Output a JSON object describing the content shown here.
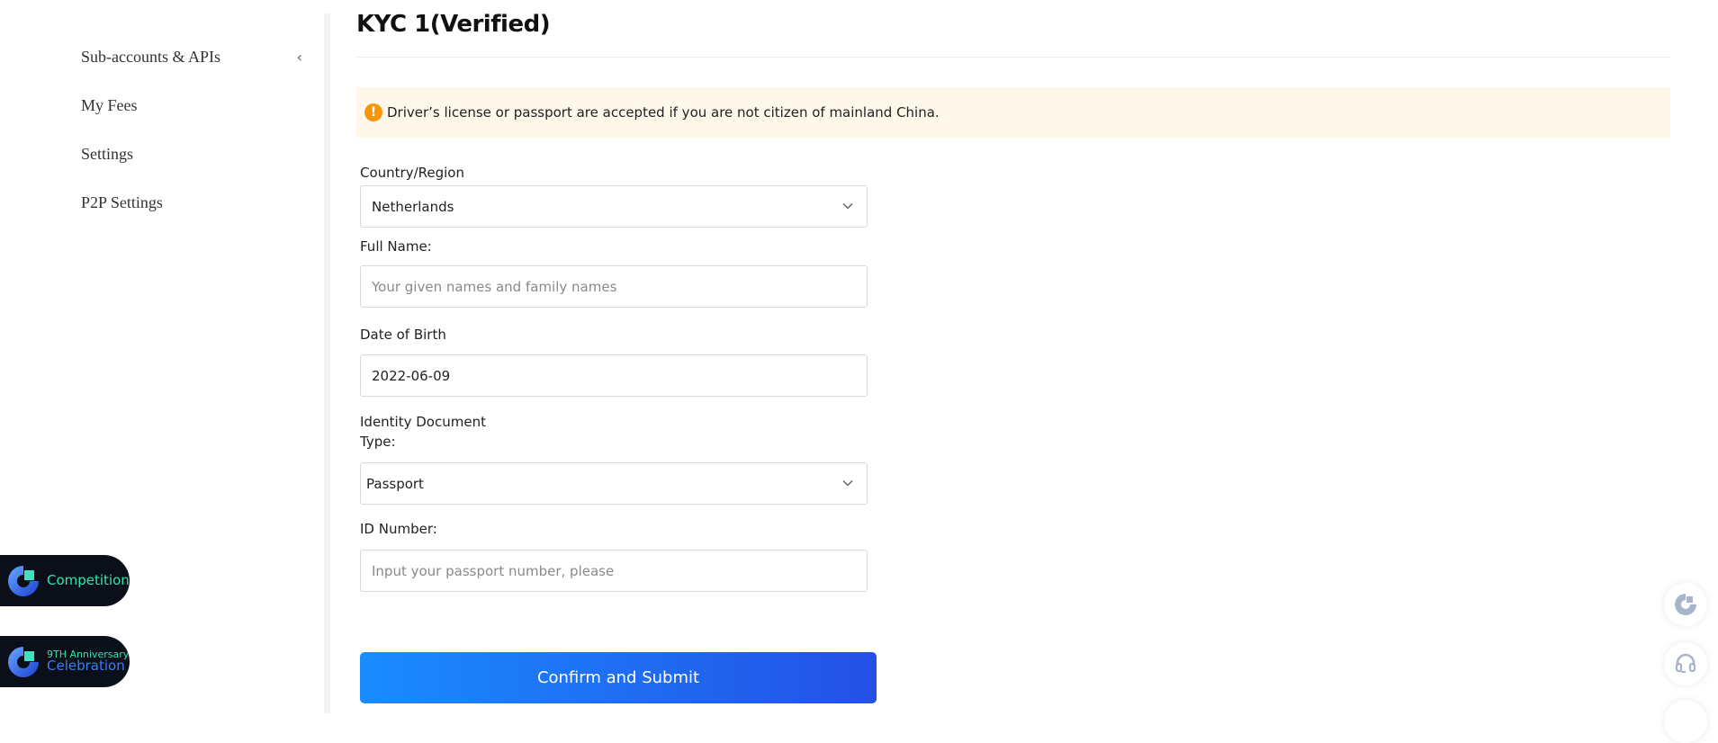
{
  "sidebar": {
    "items": [
      {
        "label": "Sub-accounts & APIs",
        "has_chevron": true,
        "chevron": "‹"
      },
      {
        "label": "My Fees",
        "has_chevron": false
      },
      {
        "label": "Settings",
        "has_chevron": false
      },
      {
        "label": "P2P Settings",
        "has_chevron": false
      }
    ],
    "promos": [
      {
        "line1": "Competition",
        "icon": "brand-logo-icon"
      },
      {
        "line1_sup": "9TH Anniversary",
        "line2": "Celebration",
        "icon": "brand-logo-icon"
      }
    ]
  },
  "header": {
    "title": "KYC 1(Verified)"
  },
  "notice": {
    "icon": "warning-icon",
    "icon_glyph": "!",
    "text": "Driver’s license or passport are accepted if you are not citizen of mainland China."
  },
  "form": {
    "country": {
      "label": "Country/Region",
      "value": "Netherlands"
    },
    "full_name": {
      "label": "Full Name:",
      "value": "",
      "placeholder": "Your given names and family names"
    },
    "dob": {
      "label": "Date of Birth",
      "value": "2022-06-09"
    },
    "id_type": {
      "label_line1": "Identity Document",
      "label_line2": "Type:",
      "value": "Passport"
    },
    "id_number": {
      "label": "ID Number:",
      "value": "",
      "placeholder": "Input your passport number, please"
    },
    "submit_label": "Confirm and Submit"
  },
  "floating": [
    {
      "icon": "brand-logo-icon"
    },
    {
      "icon": "headset-support-icon"
    }
  ],
  "colors": {
    "accent_start": "#1a8cff",
    "accent_end": "#2450e6",
    "warning": "#f6960d",
    "notice_bg": "#fef7ea"
  }
}
